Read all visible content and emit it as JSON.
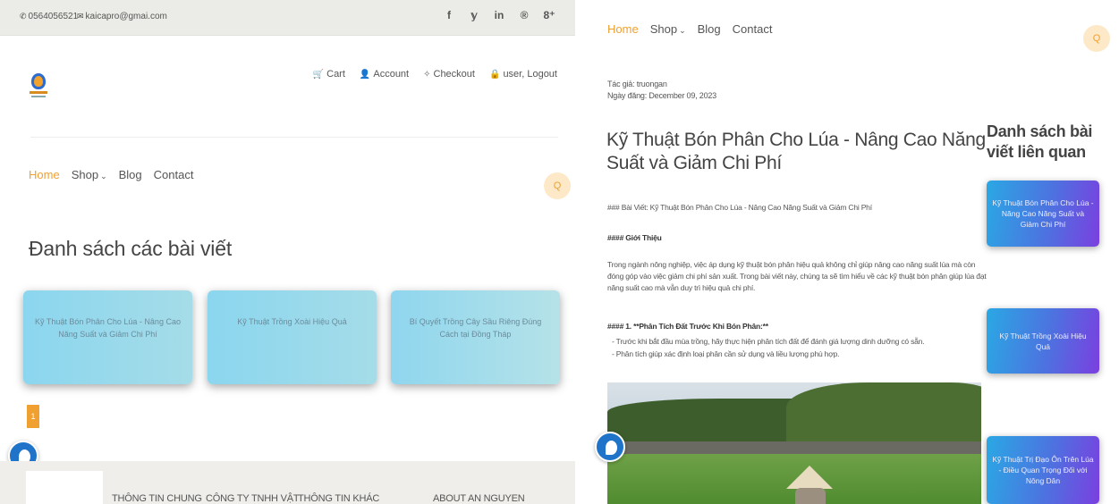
{
  "left": {
    "topbar": {
      "phone": "0564056521",
      "email": "kaicapro@gmai.com",
      "social": [
        "f",
        "𝕪",
        "in",
        "®",
        "8⁺"
      ]
    },
    "user_links": [
      "Cart",
      "Account",
      "Checkout",
      "user, Logout"
    ],
    "nav": {
      "home": "Home",
      "shop": "Shop",
      "blog": "Blog",
      "contact": "Contact"
    },
    "search_icon": "Q",
    "list_title": "Đanh sách các bài viết",
    "cards": [
      "Kỹ Thuật Bón Phân Cho Lúa - Nâng Cao Năng Suất và Giảm Chi Phí",
      "Kỹ Thuật Trồng Xoài Hiệu Quả",
      "Bí Quyết Trồng Cây Sầu Riêng Đúng Cách tại Đồng Tháp"
    ],
    "page_number": "1",
    "footer": [
      "THÔNG TIN CHUNG",
      "CÔNG TY TNHH VẬT",
      "THÔNG TIN KHÁC",
      "ABOUT AN NGUYEN"
    ]
  },
  "right": {
    "nav": {
      "home": "Home",
      "shop": "Shop",
      "blog": "Blog",
      "contact": "Contact"
    },
    "search_icon": "Q",
    "author": "Tác giả: truongan",
    "date": "Ngày đăng: December 09, 2023",
    "title": "Kỹ Thuật Bón Phân Cho Lúa - Nâng Cao Năng Suất và Giảm Chi Phí",
    "body": {
      "heading_line": "### Bài Viết: Kỹ Thuật Bón Phân Cho Lúa - Nâng Cao Năng Suất và Giảm Chi Phí",
      "intro_heading": "#### Giới Thiệu",
      "intro": "Trong ngành nông nghiệp, việc áp dụng kỹ thuật bón phân hiệu quả không chỉ giúp nâng cao năng suất lúa mà còn đóng góp vào việc giảm chi phí sản xuất. Trong bài viết này, chúng ta sẽ tìm hiểu về các kỹ thuật bón phân giúp lúa đạt năng suất cao mà vẫn duy trì hiệu quả chi phí.",
      "section1": "#### 1. **Phân Tích Đất Trước Khi Bón Phân:**",
      "bullet1": "- Trước khi bắt đầu mùa trồng, hãy thực hiện phân tích đất để đánh giá lượng dinh dưỡng có sẵn.",
      "bullet2": "- Phân tích giúp xác định loại phân cần sử dụng và liều lượng phù hợp."
    },
    "related_title": "Danh sách bài viết liên quan",
    "related": [
      "Kỹ Thuật Bón Phân Cho Lúa - Năng Cao Năng Suất và Giảm Chi Phí",
      "Kỹ Thuật Trồng Xoài Hiệu Quả",
      "Kỹ Thuật Trị Đạo Ôn Trên Lúa - Điều Quan Trọng Đối với Nông Dân"
    ]
  },
  "colors": {
    "accent": "#f0a030",
    "card_blue": "#8bd6ef",
    "related_gradient_start": "#2aa8e4",
    "related_gradient_end": "#7b3fe0"
  }
}
